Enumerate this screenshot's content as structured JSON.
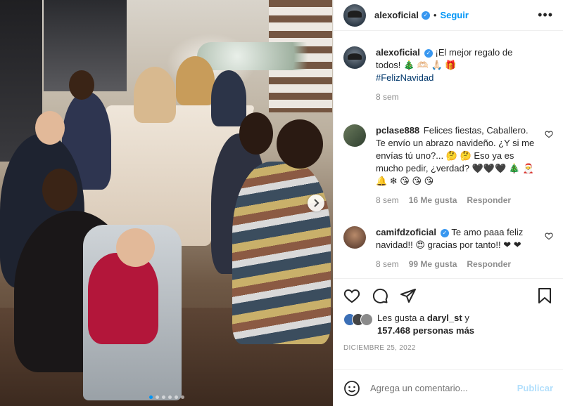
{
  "header": {
    "username": "alexoficial",
    "separator": "•",
    "follow_label": "Seguir",
    "more_label": "•••"
  },
  "caption": {
    "username": "alexoficial",
    "text": "¡El mejor regalo de todos! 🎄 🫶🏻 🙏🏻 🎁",
    "hashtag": "#FelizNavidad",
    "time": "8 sem"
  },
  "comments": [
    {
      "username": "pclase888",
      "text": "Felices fiestas, Caballero. Te envío un abrazo navideño. ¿Y si me envías tú uno?... 🤔 🤔  Eso ya es mucho pedir, ¿verdad? 🖤🖤🖤 🎄 🎅 🔔 ❄ 😘 😘 😘",
      "time": "8 sem",
      "likes": "16 Me gusta",
      "reply": "Responder"
    },
    {
      "username": "camifdzoficial",
      "text": "Te amo paaa feliz navidad!! 😍 gracias por tanto!! ❤ ❤",
      "time": "8 sem",
      "likes": "99 Me gusta",
      "reply": "Responder"
    }
  ],
  "likes": {
    "prefix": "Les gusta a",
    "user": "daryl_st",
    "conj": "y",
    "count": "157.468 personas más"
  },
  "date": "DICIEMBRE 25, 2022",
  "add_comment": {
    "placeholder": "Agrega un comentario...",
    "publish_label": "Publicar"
  },
  "carousel": {
    "dot_count": 6,
    "active_index": 0
  },
  "icons": {
    "verified": "verified-badge-icon",
    "heart": "heart-icon",
    "comment": "comment-icon",
    "share": "share-icon",
    "save": "bookmark-icon",
    "emoji": "emoji-icon",
    "next": "chevron-right-icon"
  },
  "colors": {
    "accent": "#0095f6",
    "verified": "#3897f0",
    "muted": "#8e8e8e",
    "publish_disabled": "#b2dffc"
  }
}
